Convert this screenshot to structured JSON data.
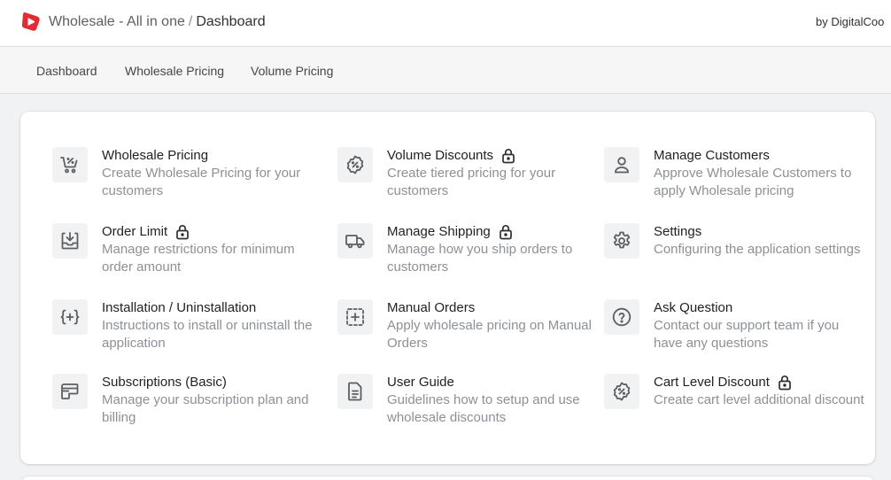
{
  "header": {
    "app_name": "Wholesale - All in one",
    "separator": "/",
    "page_name": "Dashboard",
    "byline": "by DigitalCoo",
    "brand_color": "#e42b35"
  },
  "nav": {
    "items": [
      {
        "label": "Dashboard"
      },
      {
        "label": "Wholesale Pricing"
      },
      {
        "label": "Volume Pricing"
      }
    ]
  },
  "features": [
    {
      "title": "Wholesale Pricing",
      "desc": "Create Wholesale Pricing for your customers",
      "icon": "cart-discount-icon",
      "locked": false
    },
    {
      "title": "Volume Discounts",
      "desc": "Create tiered pricing for your customers",
      "icon": "discount-badge-icon",
      "locked": true
    },
    {
      "title": "Manage Customers",
      "desc": "Approve Wholesale Customers to apply Wholesale pricing",
      "icon": "person-icon",
      "locked": false
    },
    {
      "title": "Order Limit",
      "desc": "Manage restrictions for minimum order amount",
      "icon": "inbox-download-icon",
      "locked": true
    },
    {
      "title": "Manage Shipping",
      "desc": "Manage how you ship orders to customers",
      "icon": "truck-icon",
      "locked": true
    },
    {
      "title": "Settings",
      "desc": "Configuring the application settings",
      "icon": "gear-icon",
      "locked": false
    },
    {
      "title": "Installation / Uninstallation",
      "desc": "Instructions to install or uninstall the application",
      "icon": "code-braces-icon",
      "locked": false
    },
    {
      "title": "Manual Orders",
      "desc": "Apply wholesale pricing on Manual Orders",
      "icon": "dashed-plus-icon",
      "locked": false
    },
    {
      "title": "Ask Question",
      "desc": "Contact our support team if you have any questions",
      "icon": "question-circle-icon",
      "locked": false
    },
    {
      "title": "Subscriptions (Basic)",
      "desc": "Manage your subscription plan and billing",
      "icon": "credit-card-icon",
      "locked": false
    },
    {
      "title": "User Guide",
      "desc": "Guidelines how to setup and use wholesale discounts",
      "icon": "document-icon",
      "locked": false
    },
    {
      "title": "Cart Level Discount",
      "desc": "Create cart level additional discount",
      "icon": "discount-badge-icon",
      "locked": true
    }
  ]
}
